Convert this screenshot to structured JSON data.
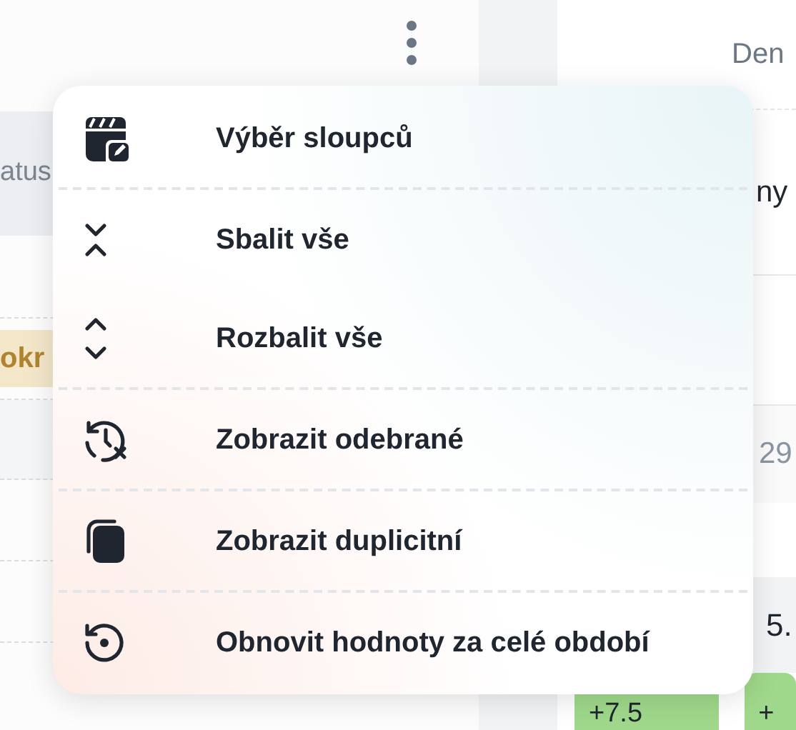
{
  "table": {
    "left_header": "atus",
    "right_header": "Den",
    "right_row_1": "ny",
    "left_badge": "okr",
    "right_row_3": "29",
    "right_row_4": "5.",
    "change_badges": [
      "+7.5",
      "+"
    ]
  },
  "menu": {
    "groups": [
      {
        "items": [
          {
            "label": "Výběr sloupců"
          }
        ]
      },
      {
        "items": [
          {
            "label": "Sbalit vše"
          },
          {
            "label": "Rozbalit vše"
          }
        ]
      },
      {
        "items": [
          {
            "label": "Zobrazit odebrané"
          }
        ]
      },
      {
        "items": [
          {
            "label": "Zobrazit duplicitní"
          }
        ]
      },
      {
        "items": [
          {
            "label": "Obnovit hodnoty za celé období"
          }
        ]
      }
    ]
  }
}
